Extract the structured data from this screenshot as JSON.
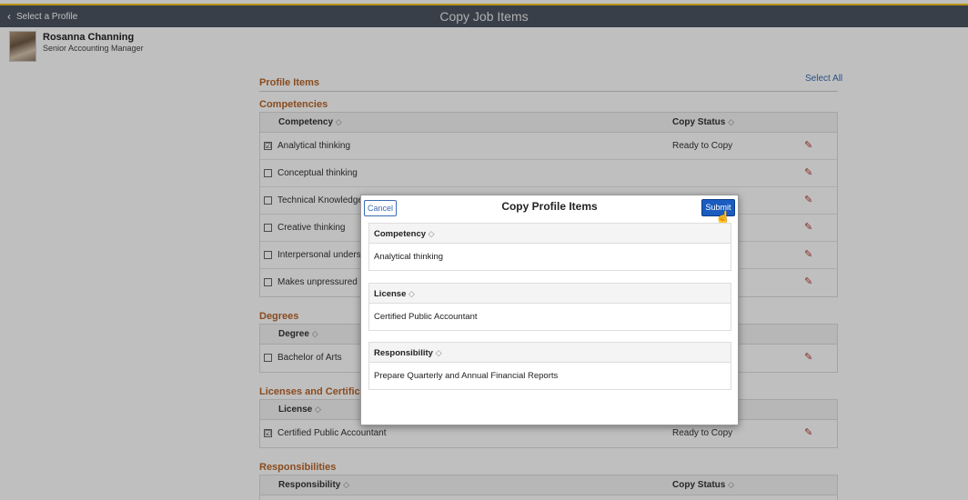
{
  "header": {
    "back_label": "Select a Profile",
    "title": "Copy Job Items"
  },
  "user": {
    "name": "Rosanna Channing",
    "role": "Senior Accounting Manager"
  },
  "profile_items": {
    "title": "Profile Items",
    "select_all": "Select All"
  },
  "competencies": {
    "title": "Competencies",
    "col1": "Competency",
    "col2": "Copy Status",
    "rows": [
      {
        "label": "Analytical thinking",
        "checked": "☑",
        "status": "Ready to Copy"
      },
      {
        "label": "Conceptual thinking",
        "checked": "",
        "status": ""
      },
      {
        "label": "Technical Knowledge",
        "checked": "",
        "status": ""
      },
      {
        "label": "Creative thinking",
        "checked": "",
        "status": ""
      },
      {
        "label": "Interpersonal understa",
        "checked": "",
        "status": ""
      },
      {
        "label": "Makes unpressured de",
        "checked": "",
        "status": ""
      }
    ]
  },
  "degrees": {
    "title": "Degrees",
    "col1": "Degree",
    "rows": [
      {
        "label": "Bachelor of Arts",
        "checked": ""
      }
    ]
  },
  "licenses": {
    "title": "Licenses and Certificat",
    "col1": "License",
    "rows": [
      {
        "label": "Certified Public Accountant",
        "checked": "☑",
        "status": "Ready to Copy"
      }
    ]
  },
  "responsibilities": {
    "title": "Responsibilities",
    "col1": "Responsibility",
    "col2": "Copy Status"
  },
  "sort_glyph": "◇",
  "edit_glyph": "✎",
  "modal": {
    "cancel": "Cancel",
    "title": "Copy Profile Items",
    "submit": "Submit",
    "sections": [
      {
        "header": "Competency",
        "value": "Analytical thinking"
      },
      {
        "header": "License",
        "value": "Certified Public Accountant"
      },
      {
        "header": "Responsibility",
        "value": "Prepare Quarterly and Annual Financial Reports"
      }
    ]
  },
  "colors": {
    "header_bg": "#4b5562",
    "accent": "#f6c51c",
    "section_title": "#b8662a",
    "link": "#3b6bb5",
    "submit_bg": "#1a5cbf"
  }
}
